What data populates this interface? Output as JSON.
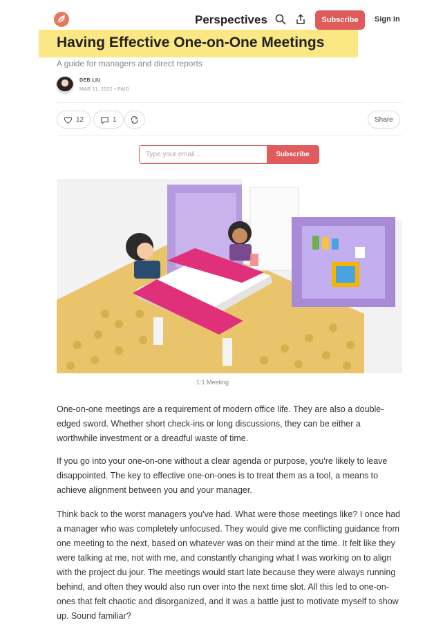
{
  "header": {
    "site_title": "Perspectives",
    "subscribe_label": "Subscribe",
    "signin_label": "Sign in"
  },
  "post": {
    "title": "Having Effective One-on-One Meetings",
    "subtitle": "A guide for managers and direct reports",
    "author": "DEB LIU",
    "meta": "MAR 11, 2022 • PAID"
  },
  "actions": {
    "like_count": "12",
    "comment_count": "1",
    "share_label": "Share"
  },
  "subscribe_form": {
    "placeholder": "Type your email...",
    "button_label": "Subscribe"
  },
  "image": {
    "caption": "1:1 Meeting"
  },
  "body": {
    "paragraphs": [
      "One-on-one meetings are a requirement of modern office life. They are also a double-edged sword. Whether short check-ins or long discussions, they can be either a worthwhile investment or a dreadful waste of time.",
      "If you go into your one-on-one without a clear agenda or purpose, you're likely to leave disappointed. The key to effective one-on-ones is to treat them as a tool, a means to achieve alignment between you and your manager.",
      "Think back to the worst managers you've had. What were those meetings like? I once had a manager who was completely unfocused. They would give me conflicting guidance from one meeting to the next, based on whatever was on their mind at the time. It felt like they were talking at me, not with me, and constantly changing what I was working on to align with the project du jour. The meetings would start late because they were always running behind, and often they would also run over into the next time slot. All this led to one-on-ones that felt chaotic and disorganized, and it was a battle just to motivate myself to show up. Sound familiar?"
    ]
  },
  "colors": {
    "accent": "#e05b5b",
    "title_highlight": "#fbe784"
  },
  "icons": [
    "leaf-logo-icon",
    "search-icon",
    "share-upload-icon",
    "heart-icon",
    "comment-icon",
    "restack-icon"
  ]
}
